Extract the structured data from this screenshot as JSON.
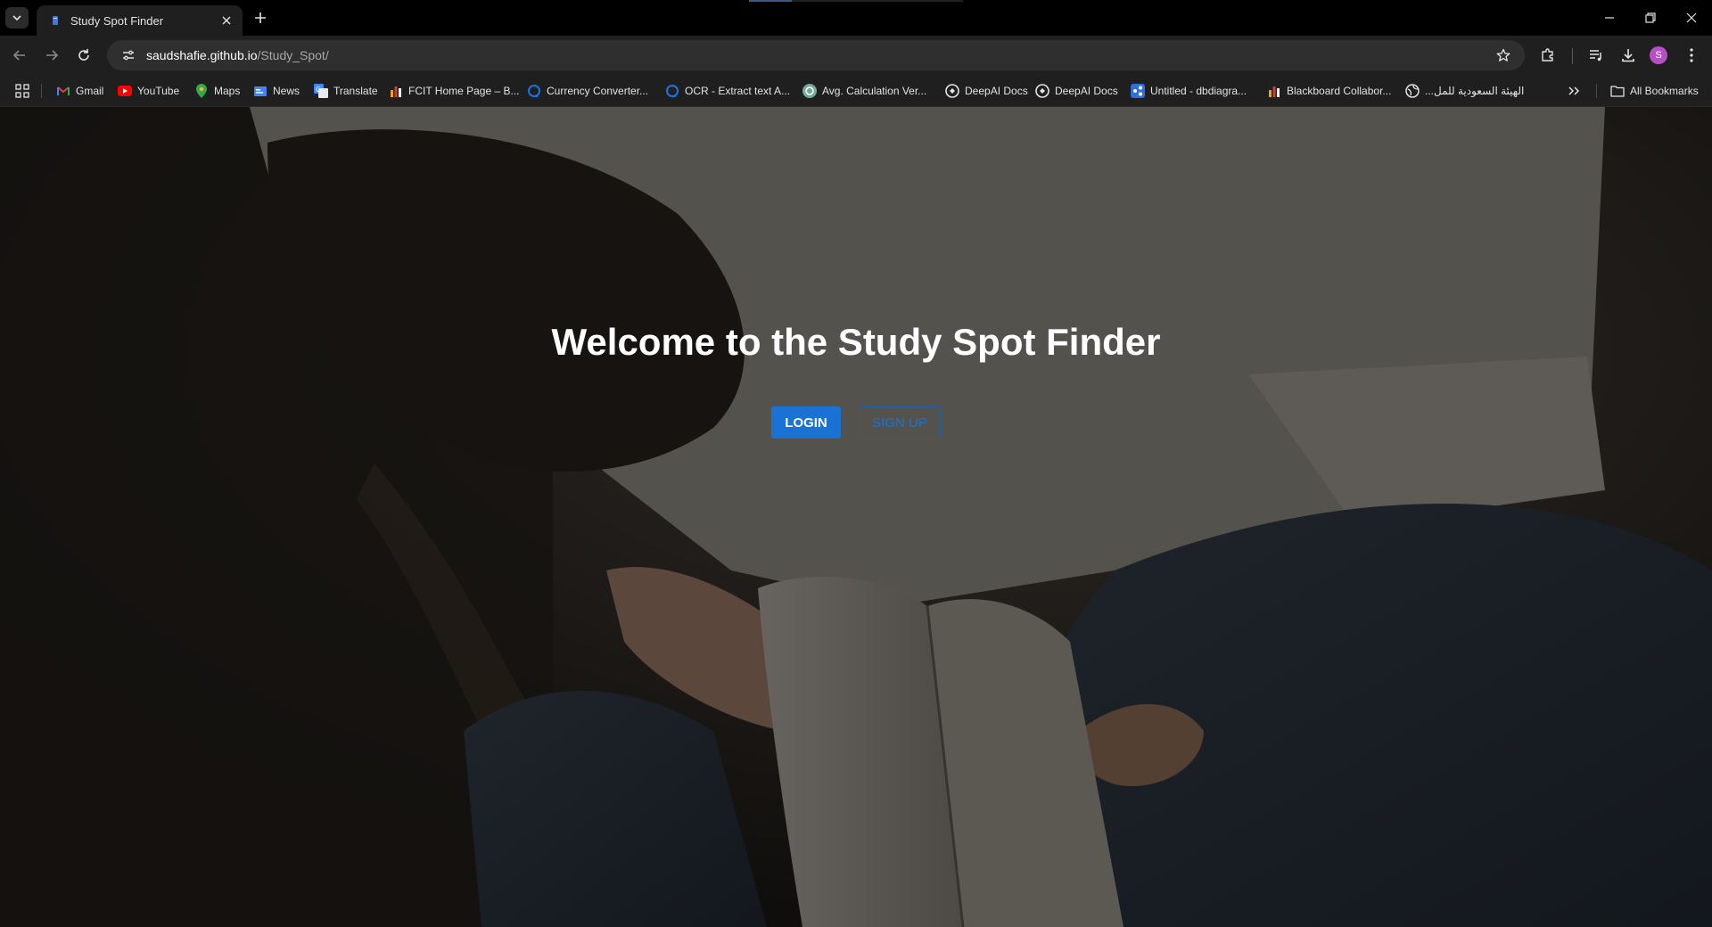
{
  "browser": {
    "tab": {
      "title": "Study Spot Finder"
    },
    "address": {
      "host": "saudshafie.github.io",
      "path": "/Study_Spot/"
    },
    "profile_initial": "S",
    "bookmarks": [
      {
        "label": "Gmail",
        "icon": "gmail-icon"
      },
      {
        "label": "YouTube",
        "icon": "youtube-icon"
      },
      {
        "label": "Maps",
        "icon": "maps-icon"
      },
      {
        "label": "News",
        "icon": "news-icon"
      },
      {
        "label": "Translate",
        "icon": "translate-icon"
      },
      {
        "label": "FCIT Home Page – B...",
        "icon": "bar-chart-icon"
      },
      {
        "label": "Currency Converter...",
        "icon": "currency-icon"
      },
      {
        "label": "OCR - Extract text A...",
        "icon": "ocr-icon"
      },
      {
        "label": "Avg. Calculation Ver...",
        "icon": "chatgpt-icon"
      },
      {
        "label": "DeepAI Docs",
        "icon": "deepai-icon"
      },
      {
        "label": "DeepAI Docs",
        "icon": "deepai-icon"
      },
      {
        "label": "Untitled - dbdiagra...",
        "icon": "dbdiagram-icon"
      },
      {
        "label": "Blackboard Collabor...",
        "icon": "bar-chart-icon"
      },
      {
        "label": "الهيئة السعودية للمل...",
        "icon": "globe-icon"
      }
    ],
    "all_bookmarks_label": "All Bookmarks"
  },
  "page": {
    "title": "Welcome to the Study Spot Finder",
    "login_label": "LOGIN",
    "signup_label": "SIGN UP"
  },
  "colors": {
    "primary_button": "#1a73d4",
    "profile_avatar": "#b84ec6"
  }
}
